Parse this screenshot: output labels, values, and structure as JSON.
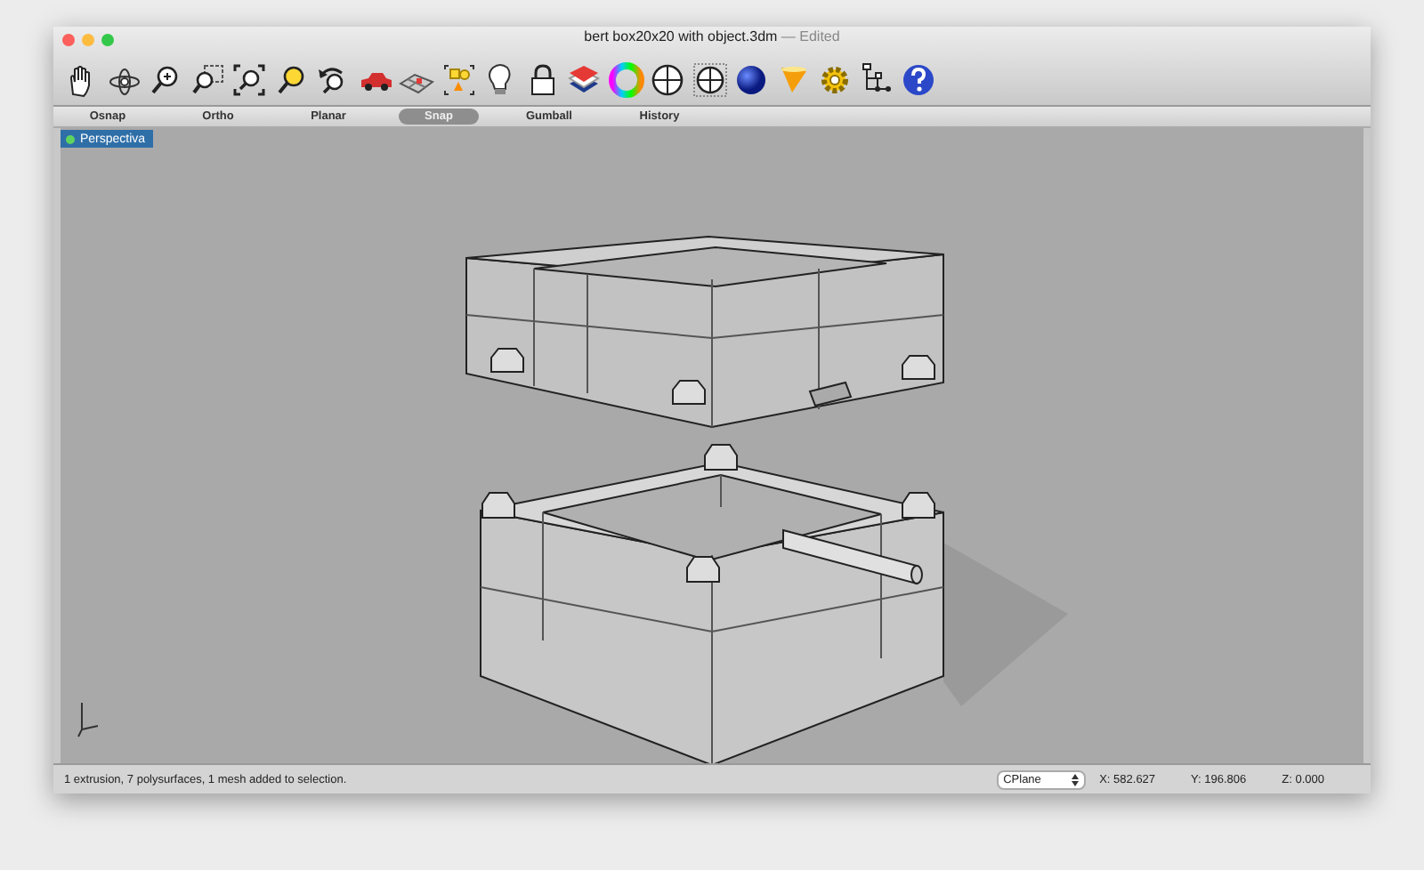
{
  "window": {
    "title": "bert box20x20 with object.3dm",
    "status": "— Edited"
  },
  "tabs": [
    {
      "label": "Osnap",
      "selected": false
    },
    {
      "label": "Ortho",
      "selected": false
    },
    {
      "label": "Planar",
      "selected": false
    },
    {
      "label": "Snap",
      "selected": true
    },
    {
      "label": "Gumball",
      "selected": false
    },
    {
      "label": "History",
      "selected": false
    }
  ],
  "viewport": {
    "label": "Perspectiva"
  },
  "status_bar": {
    "message": "1 extrusion, 7 polysurfaces, 1 mesh added to selection.",
    "cplane": "CPlane",
    "x": "X: 582.627",
    "y": "Y: 196.806",
    "z": "Z: 0.000"
  }
}
